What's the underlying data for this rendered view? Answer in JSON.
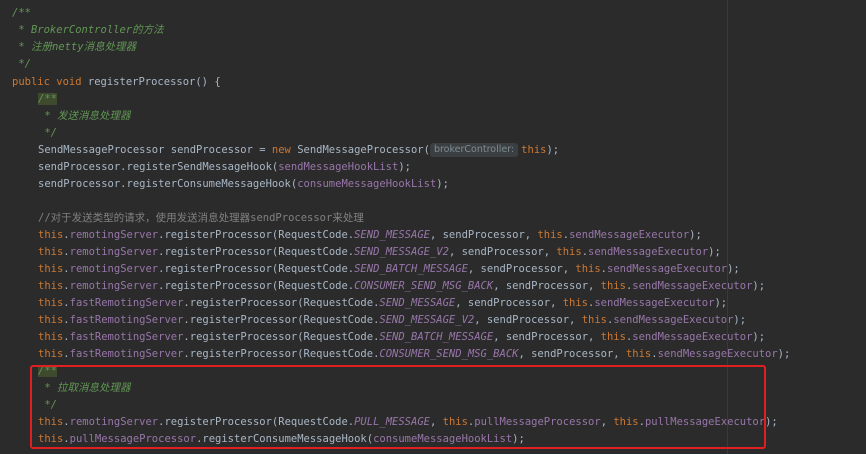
{
  "code": {
    "l1": "/**",
    "l2": " * BrokerController的方法",
    "l3": " * 注册netty消息处理器",
    "l4": " */",
    "l5_kw1": "public",
    "l5_kw2": "void",
    "l5_rest": "registerProcessor() {",
    "l6": "/**",
    "l7": " * 发送消息处理器",
    "l8": " */",
    "l9_a": "SendMessageProcessor sendProcessor = ",
    "l9_new": "new",
    "l9_b": " SendMessageProcessor(",
    "l9_hint": "brokerController:",
    "l9_this": "this",
    "l9_end": ");",
    "l10_a": "sendProcessor.registerSendMessageHook(",
    "l10_f": "sendMessageHookList",
    "l10_end": ");",
    "l11_a": "sendProcessor.registerConsumeMessageHook(",
    "l11_f": "consumeMessageHookList",
    "l11_end": ");",
    "l12": "//对于发送类型的请求，使用发送消息处理器sendProcessor来处理",
    "this": "this",
    "remotingServer": "remotingServer",
    "fastRemotingServer": "fastRemotingServer",
    "reg": ".registerProcessor(RequestCode.",
    "sendProcessor": ", sendProcessor, ",
    "sendExec": "sendMessageExecutor",
    "end": ");",
    "dot": ".",
    "c_send": "SEND_MESSAGE",
    "c_send_v2": "SEND_MESSAGE_V2",
    "c_batch": "SEND_BATCH_MESSAGE",
    "c_back": "CONSUMER_SEND_MSG_BACK",
    "l22": "/**",
    "l23": " * 拉取消息处理器",
    "l24": " */",
    "c_pull": "PULL_MESSAGE",
    "pull_mid": ", ",
    "pullProc": "pullMessageProcessor",
    "pullExec": "pullMessageExecutor",
    "l26_b": ".registerConsumeMessageHook(",
    "consumeHook": "consumeMessageHookList"
  }
}
